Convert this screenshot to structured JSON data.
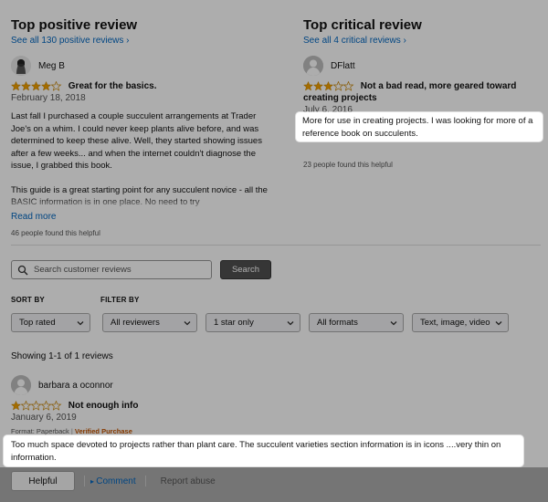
{
  "top_positive": {
    "title": "Top positive review",
    "see_all": "See all 130 positive reviews ›",
    "reviewer": "Meg B",
    "rating": 4,
    "headline": "Great for the basics.",
    "date": "February 18, 2018",
    "paragraph1": "Last fall I purchased a couple succulent arrangements at Trader Joe's on a whim. I could never keep plants alive before, and was determined to keep these alive. Well, they started showing issues after a few weeks... and when the internet couldn't diagnose the issue, I grabbed this book.",
    "paragraph2": "This guide is a great starting point for any succulent novice - all the BASIC information is in one place. No need to try",
    "read_more": "Read more",
    "helpful": "46 people found this helpful"
  },
  "top_critical": {
    "title": "Top critical review",
    "see_all": "See all 4 critical reviews ›",
    "reviewer": "DFlatt",
    "rating": 3,
    "headline": "Not a bad read, more geared toward creating projects",
    "date": "July 6, 2016",
    "body": "More for use in creating projects. I was looking for more of a reference book on succulents.",
    "helpful": "23 people found this helpful"
  },
  "search": {
    "placeholder": "Search customer reviews",
    "button": "Search"
  },
  "sort": {
    "label": "SORT BY",
    "selected": "Top rated"
  },
  "filter": {
    "label": "FILTER BY",
    "reviewers": "All reviewers",
    "stars": "1 star only",
    "formats": "All formats",
    "media": "Text, image, video"
  },
  "showing": "Showing 1-1 of 1 reviews",
  "review": {
    "reviewer": "barbara a oconnor",
    "rating": 1,
    "headline": "Not enough info",
    "date": "January 6, 2019",
    "format": "Format: Paperback",
    "verified": "Verified Purchase",
    "body": "Too much space devoted to projects rather than plant care. The succulent varieties section information is in icons ....very thin on information.",
    "helpful_button": "Helpful",
    "comment": "Comment",
    "report": "Report abuse"
  },
  "colors": {
    "star": "#f0a000",
    "link": "#0066c0",
    "verified": "#c45500",
    "overlay": "rgba(0,0,0,0.32)"
  }
}
